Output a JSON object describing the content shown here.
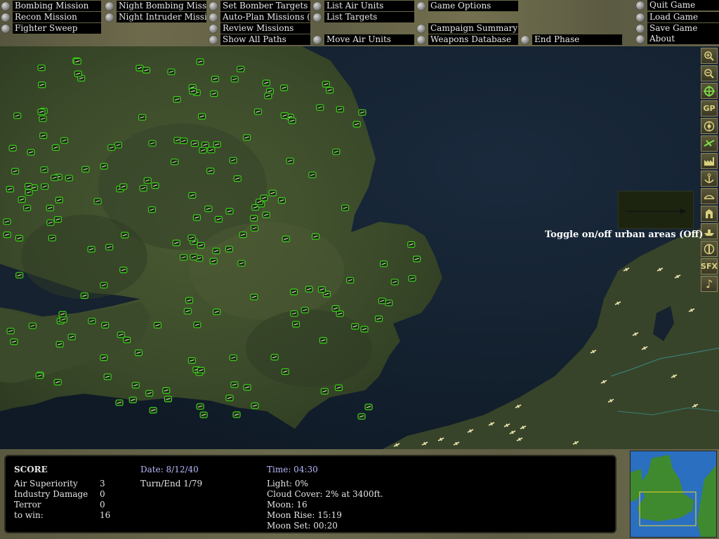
{
  "menu": {
    "bombing_mission": "Bombing Mission",
    "recon_mission": "Recon Mission",
    "fighter_sweep": "Fighter Sweep",
    "night_bombing_mission": "Night Bombing Mission",
    "night_intruder_mission": "Night Intruder Mission",
    "set_bomber_targets": "Set Bomber Targets",
    "auto_plan_missions": "Auto-Plan Missions (Off)",
    "review_missions": "Review Missions",
    "show_all_paths": "Show All Paths",
    "list_air_units": "List Air Units",
    "list_targets": "List Targets",
    "move_air_units": "Move Air Units",
    "game_options": "Game Options",
    "campaign_summary": "Campaign Summary",
    "weapons_database": "Weapons Database",
    "end_phase": "End Phase",
    "quit_game": "Quit Game",
    "load_game": "Load Game",
    "save_game": "Save Game",
    "about": "About"
  },
  "toolbar": {
    "zoom_in_icon": "zoom-in-icon",
    "zoom_out_icon": "zoom-out-icon",
    "center_icon": "target-crosshair-icon",
    "gp_label": "GP",
    "sfx_label": "SFX",
    "music_glyph": "♪"
  },
  "tooltip": {
    "text": "Toggle on/off urban areas (Off)"
  },
  "status": {
    "score_label": "SCORE",
    "air_superiority_label": "Air Superiority",
    "air_superiority_value": "3",
    "industry_damage_label": "Industry Damage",
    "industry_damage_value": "0",
    "terror_label": "Terror",
    "terror_value": "0",
    "to_win_label": "to win:",
    "to_win_value": "16",
    "date": "Date: 8/12/40",
    "turn": "Turn/End 1/79",
    "time": "Time: 04:30",
    "light": "Light: 0%",
    "cloud_cover": "Cloud Cover: 2% at 3400ft.",
    "moon": "Moon: 16",
    "moon_rise": "Moon Rise: 15:19",
    "moon_set": "Moon Set: 00:20"
  },
  "colors": {
    "unit_green": "#3cd21c",
    "enemy_unit": "#f0e8b0",
    "sea": "#12202e",
    "land": "#3f4f2c",
    "date_blue": "#b8b8ff"
  }
}
